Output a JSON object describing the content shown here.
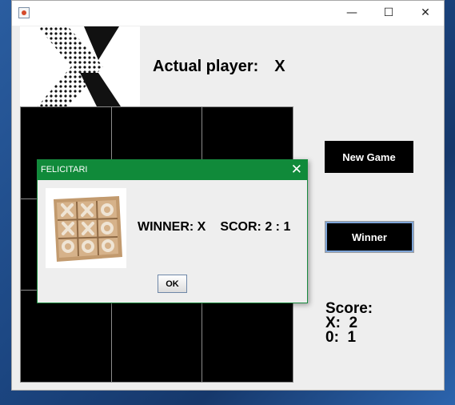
{
  "window": {
    "minimize_glyph": "—",
    "maximize_glyph": "☐",
    "close_glyph": "✕"
  },
  "main": {
    "actual_player_label": "Actual player:",
    "actual_player_value": "X",
    "new_game_label": "New Game",
    "winner_label": "Winner",
    "score": {
      "title": "Score:",
      "x_line": "X:  2",
      "o_line": "0:  1"
    }
  },
  "dialog": {
    "title": "FELICITARI",
    "close_glyph": "✕",
    "winner_text": "WINNER: X",
    "score_text": "SCOR: 2 : 1",
    "ok_label": "OK"
  },
  "colors": {
    "dialog_title_bg": "#108a3a",
    "board_cell": "#000000",
    "button_bg": "#000000"
  }
}
